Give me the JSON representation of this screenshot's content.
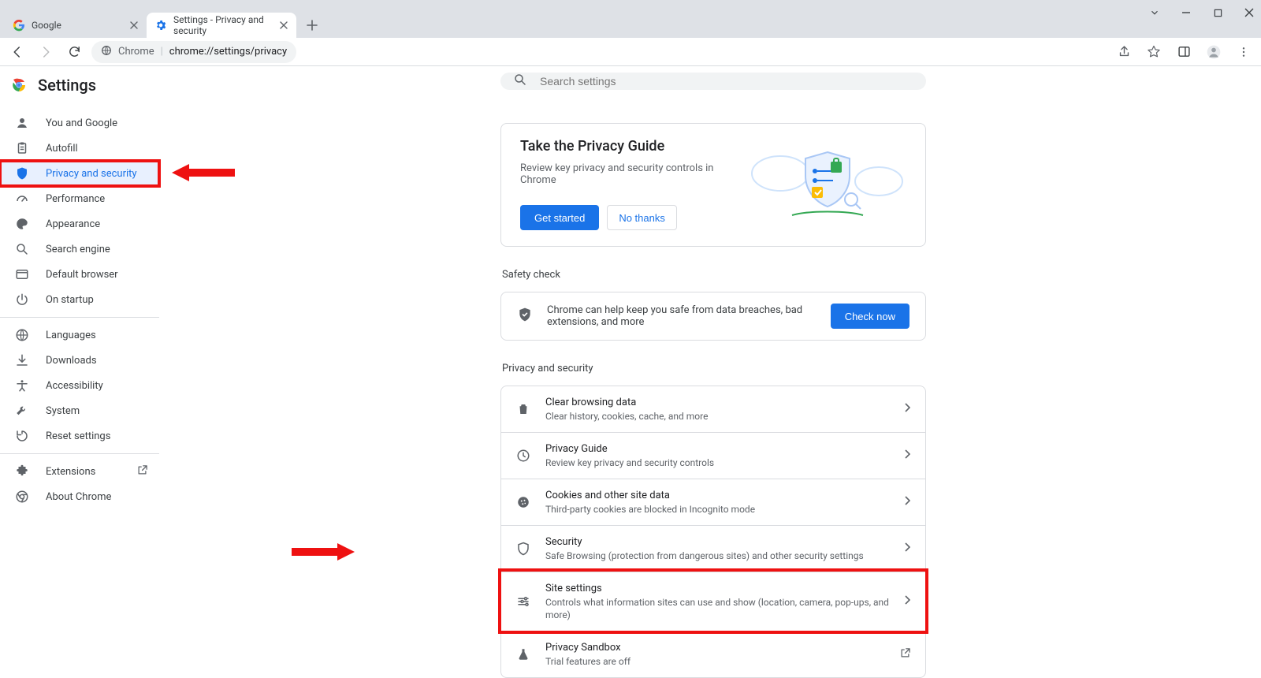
{
  "window": {
    "tabs": [
      {
        "label": "Google",
        "active": false
      },
      {
        "label": "Settings - Privacy and security",
        "active": true
      }
    ]
  },
  "toolbar": {
    "url_prefix": "Chrome",
    "url_path": "chrome://settings/privacy"
  },
  "header": {
    "title": "Settings"
  },
  "search": {
    "placeholder": "Search settings"
  },
  "sidebar": {
    "group1": [
      {
        "id": "you",
        "label": "You and Google"
      },
      {
        "id": "autofill",
        "label": "Autofill"
      },
      {
        "id": "privacy",
        "label": "Privacy and security",
        "active": true,
        "highlighted": true
      },
      {
        "id": "performance",
        "label": "Performance"
      },
      {
        "id": "appearance",
        "label": "Appearance"
      },
      {
        "id": "search",
        "label": "Search engine"
      },
      {
        "id": "default",
        "label": "Default browser"
      },
      {
        "id": "startup",
        "label": "On startup"
      }
    ],
    "group2": [
      {
        "id": "languages",
        "label": "Languages"
      },
      {
        "id": "downloads",
        "label": "Downloads"
      },
      {
        "id": "accessibility",
        "label": "Accessibility"
      },
      {
        "id": "system",
        "label": "System"
      },
      {
        "id": "reset",
        "label": "Reset settings"
      }
    ],
    "group3": [
      {
        "id": "extensions",
        "label": "Extensions",
        "external": true
      },
      {
        "id": "about",
        "label": "About Chrome"
      }
    ]
  },
  "guide": {
    "title": "Take the Privacy Guide",
    "subtitle": "Review key privacy and security controls in Chrome",
    "primary": "Get started",
    "secondary": "No thanks"
  },
  "safety": {
    "section_label": "Safety check",
    "text": "Chrome can help keep you safe from data breaches, bad extensions, and more",
    "button": "Check now"
  },
  "privacy_section": {
    "label": "Privacy and security",
    "items": [
      {
        "id": "clear",
        "title": "Clear browsing data",
        "sub": "Clear history, cookies, cache, and more"
      },
      {
        "id": "pguide",
        "title": "Privacy Guide",
        "sub": "Review key privacy and security controls"
      },
      {
        "id": "cookies",
        "title": "Cookies and other site data",
        "sub": "Third-party cookies are blocked in Incognito mode"
      },
      {
        "id": "security",
        "title": "Security",
        "sub": "Safe Browsing (protection from dangerous sites) and other security settings"
      },
      {
        "id": "site",
        "title": "Site settings",
        "sub": "Controls what information sites can use and show (location, camera, pop-ups, and more)",
        "highlighted": true
      },
      {
        "id": "sandbox",
        "title": "Privacy Sandbox",
        "sub": "Trial features are off",
        "external": true
      }
    ]
  }
}
